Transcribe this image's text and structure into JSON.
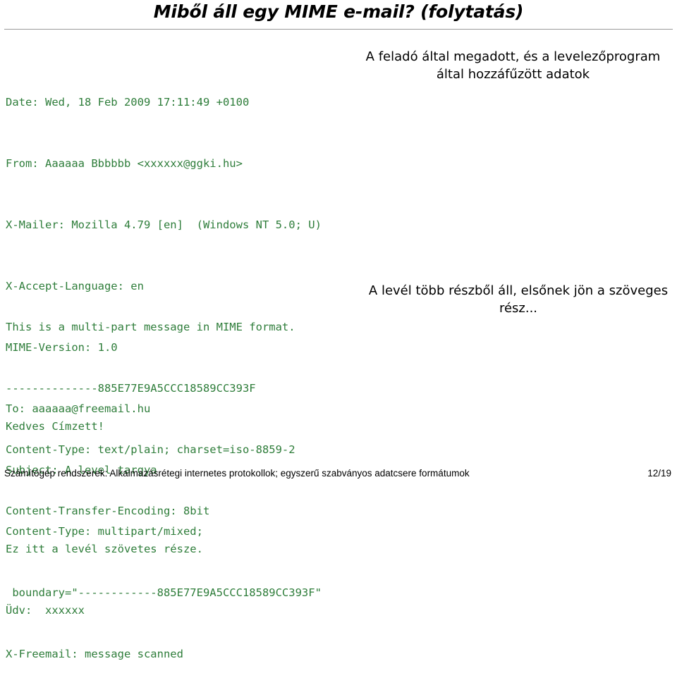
{
  "slide": {
    "title": "Miből áll egy MIME e-mail? (folytatás)",
    "accent_green": "#2e7d3a",
    "rule_color": "#9a9a9a"
  },
  "mail_source": {
    "lines": [
      "Date: Wed, 18 Feb 2009 17:11:49 +0100",
      "From: Aaaaaa Bbbbbb <xxxxxx@ggki.hu>",
      "X-Mailer: Mozilla 4.79 [en]  (Windows NT 5.0; U)",
      "X-Accept-Language: en",
      "MIME-Version: 1.0",
      "To: aaaaaa@freemail.hu",
      "Subject: A level targya",
      "Content-Type: multipart/mixed;",
      " boundary=\"------------885E77E9A5CCC18589CC393F\"",
      "X-Freemail: message scanned"
    ]
  },
  "mail_body": {
    "lines": [
      "This is a multi-part message in MIME format.",
      "--------------885E77E9A5CCC18589CC393F",
      "Content-Type: text/plain; charset=iso-8859-2",
      "Content-Transfer-Encoding: 8bit"
    ]
  },
  "mail_text": {
    "lines": [
      "Kedves Címzett!",
      "",
      "Ez itt a levél szövetes része.",
      "Üdv:  xxxxxx"
    ]
  },
  "annotations": {
    "top": "A feladó által megadott, és a levelezőprogram által hozzáfűzött adatok",
    "middle": "A levél több részből áll, elsőnek jön a szöveges rész..."
  },
  "footer": {
    "text": "Számítógép rendszerek: Alkalmazásrétegi internetes protokollok; egyszerű szabványos adatcsere formátumok",
    "page": "12/19"
  }
}
